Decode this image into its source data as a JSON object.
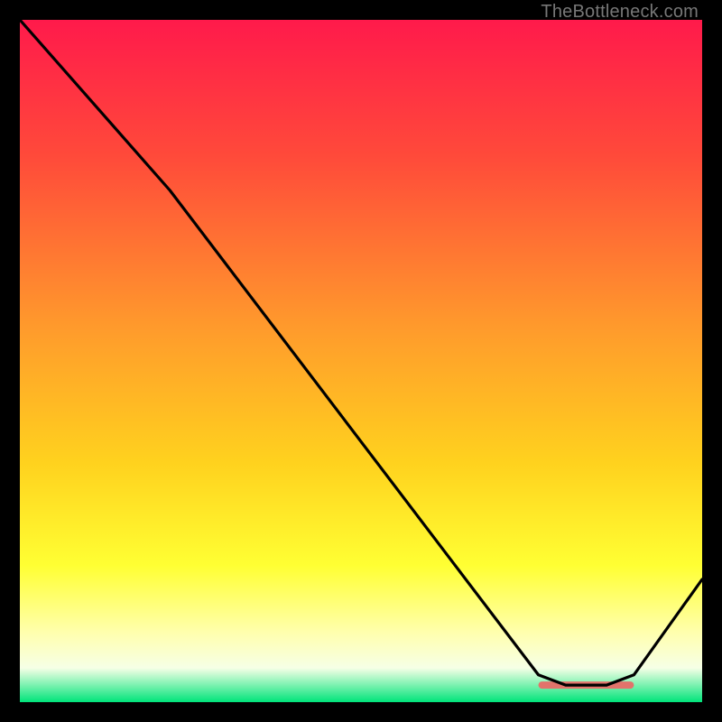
{
  "attribution": "TheBottleneck.com",
  "chart_data": {
    "type": "line",
    "title": "",
    "xlabel": "",
    "ylabel": "",
    "xlim": [
      0,
      100
    ],
    "ylim": [
      0,
      100
    ],
    "gradient_stops": [
      {
        "offset": 0,
        "color": "#ff1a4b"
      },
      {
        "offset": 20,
        "color": "#ff4a3a"
      },
      {
        "offset": 45,
        "color": "#ff9a2c"
      },
      {
        "offset": 65,
        "color": "#ffd21e"
      },
      {
        "offset": 80,
        "color": "#ffff33"
      },
      {
        "offset": 90,
        "color": "#ffffb0"
      },
      {
        "offset": 95,
        "color": "#f6ffe6"
      },
      {
        "offset": 100,
        "color": "#00e47a"
      }
    ],
    "series": [
      {
        "name": "bottleneck-curve",
        "points": [
          {
            "x": 0,
            "y": 100
          },
          {
            "x": 22,
            "y": 75
          },
          {
            "x": 76,
            "y": 4
          },
          {
            "x": 80,
            "y": 2.5
          },
          {
            "x": 86,
            "y": 2.5
          },
          {
            "x": 90,
            "y": 4
          },
          {
            "x": 100,
            "y": 18
          }
        ]
      }
    ],
    "highlight_segment": {
      "x_start": 76,
      "x_end": 90,
      "y": 2.5,
      "color": "#e2736b"
    }
  }
}
